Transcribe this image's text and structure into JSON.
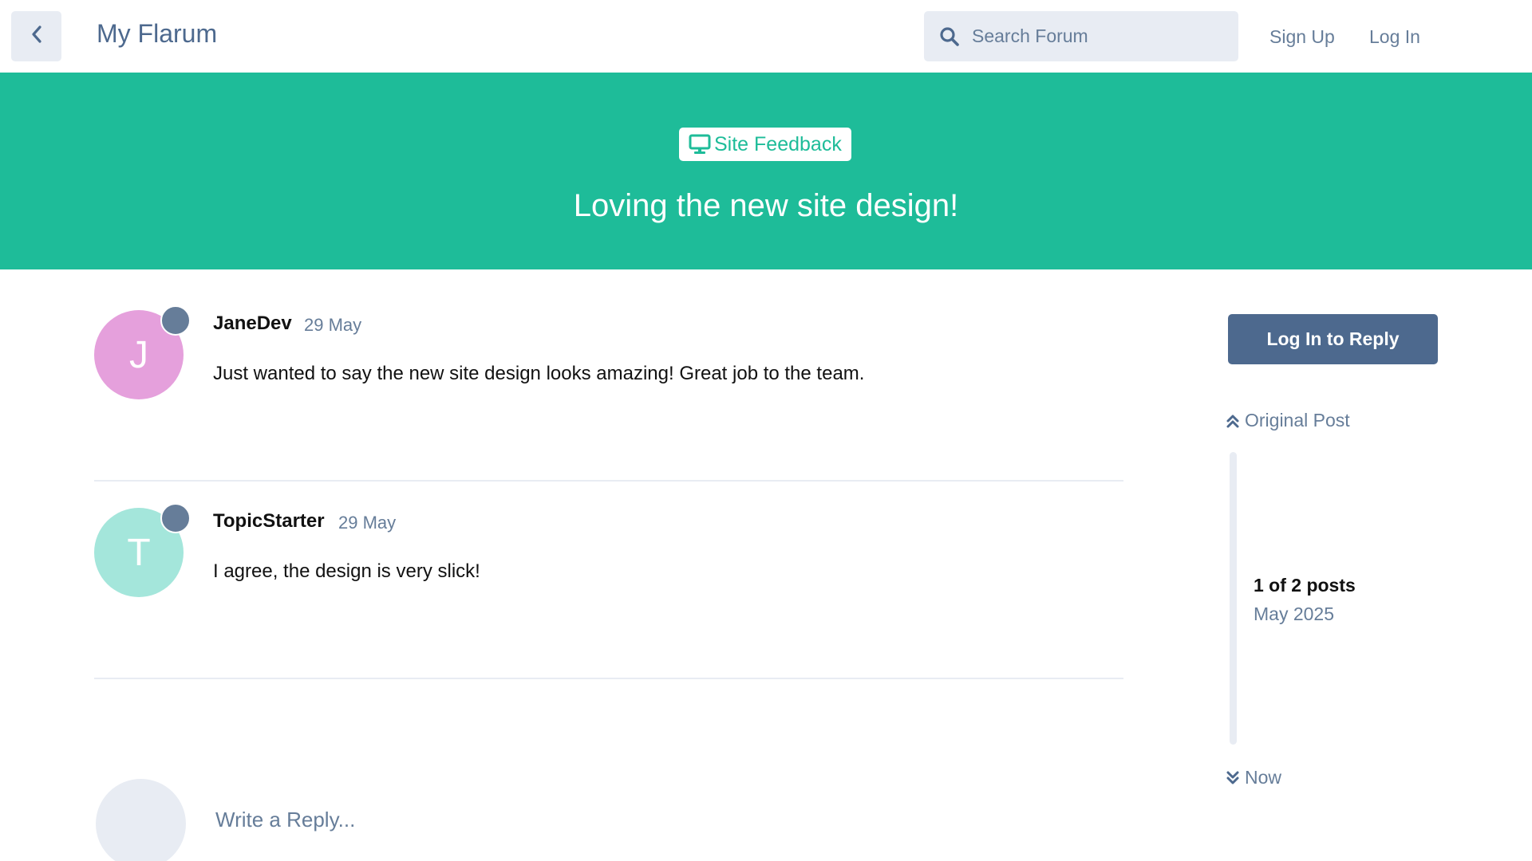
{
  "header": {
    "site_title": "My Flarum",
    "search_placeholder": "Search Forum",
    "sign_up": "Sign Up",
    "log_in": "Log In",
    "back_icon": "chevron-left-icon",
    "search_icon": "search-icon"
  },
  "hero": {
    "tag": "Site Feedback",
    "tag_icon": "desktop-icon",
    "title": "Loving the new site design!",
    "color": "#1ebc99"
  },
  "posts": [
    {
      "avatar_letter": "J",
      "avatar_color": "#e5a0dc",
      "author": "JaneDev",
      "date": "29 May",
      "body": "Just wanted to say the new site design looks amazing! Great job to the team."
    },
    {
      "avatar_letter": "T",
      "avatar_color": "#a4e6db",
      "author": "TopicStarter",
      "date": "29 May",
      "body": "I agree, the design is very slick!"
    }
  ],
  "composer": {
    "placeholder": "Write a Reply..."
  },
  "sidebar": {
    "reply_button": "Log In to Reply",
    "original_post": "Original Post",
    "position": "1 of 2 posts",
    "position_date": "May 2025",
    "now": "Now",
    "accent": "#4d698e"
  }
}
